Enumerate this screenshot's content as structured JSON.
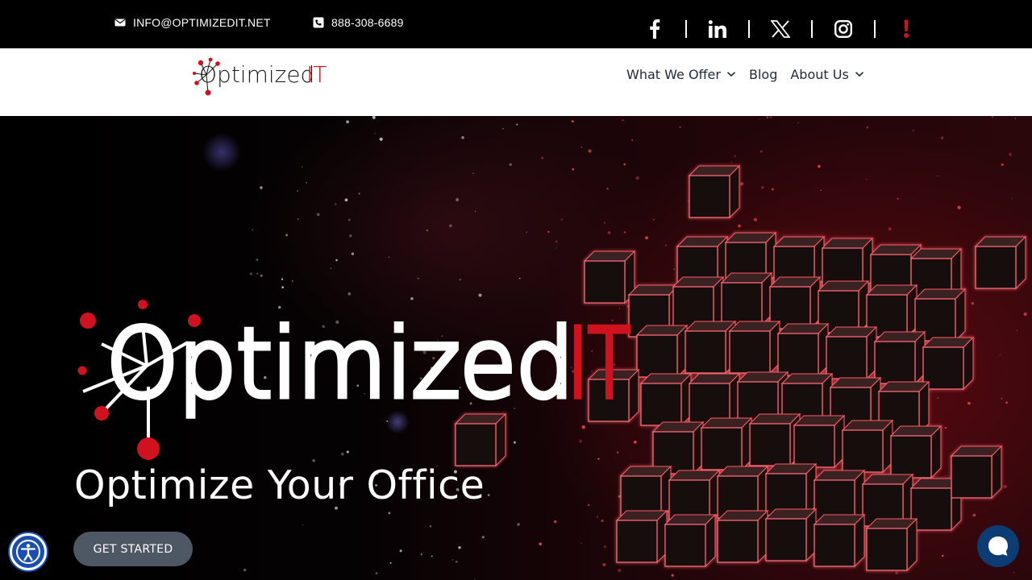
{
  "topbar": {
    "email": "INFO@OPTIMIZEDIT.NET",
    "phone": "888-308-6689",
    "social": [
      "facebook-icon",
      "linkedin-icon",
      "x-icon",
      "instagram-icon",
      "yelp-icon"
    ]
  },
  "header": {
    "logo_text": "Optimized",
    "logo_accent": "IT",
    "nav": [
      {
        "label": "What We Offer",
        "has_dropdown": true
      },
      {
        "label": "Blog",
        "has_dropdown": false
      },
      {
        "label": "About Us",
        "has_dropdown": true
      }
    ]
  },
  "hero": {
    "logo_text": "Optimized",
    "logo_accent": "IT",
    "title": "Optimize Your Office",
    "cta": "GET STARTED"
  },
  "colors": {
    "brand_red": "#d0111e",
    "topbar_bg": "#000000",
    "nav_text": "#1e2a3a",
    "cta_bg": "#4d5864",
    "accessibility_blue": "#1a4fb0",
    "chat_blue": "#0b3d74"
  }
}
